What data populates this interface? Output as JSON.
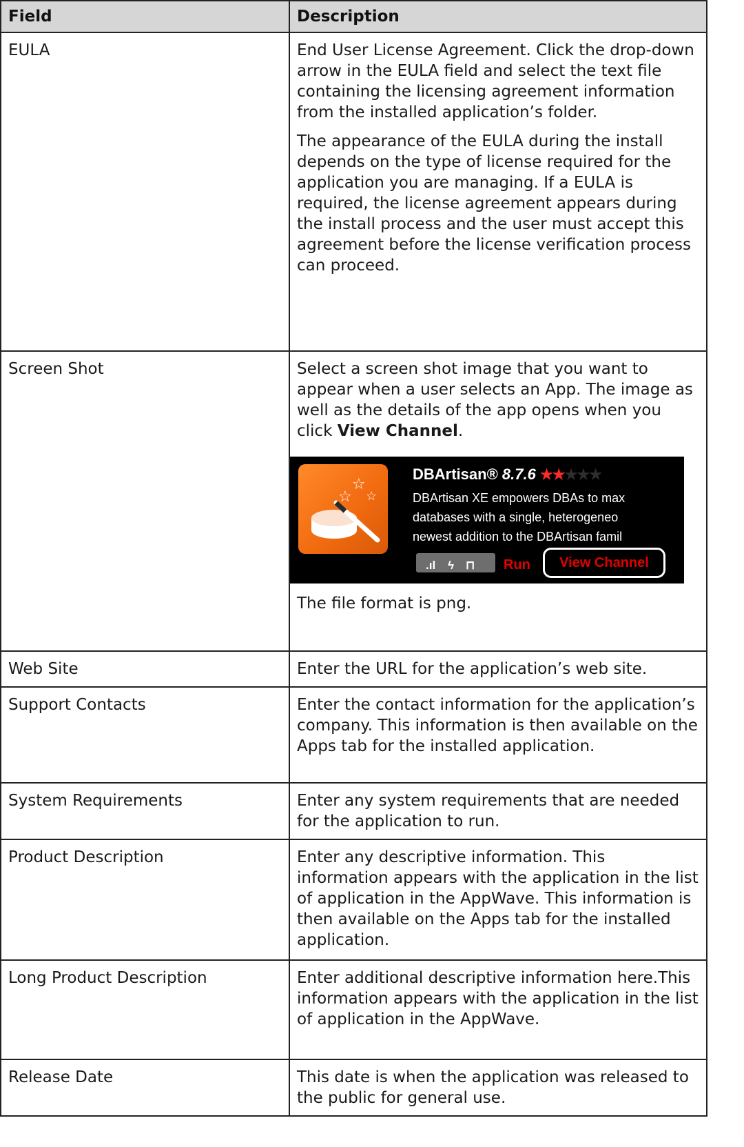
{
  "headers": {
    "field": "Field",
    "description": "Description"
  },
  "rows": [
    {
      "field": "EULA",
      "paragraphs": [
        "End User License Agreement. Click the drop-down arrow in the EULA field and select the text file containing the licensing agreement information from the installed application’s folder.",
        "The appearance of the EULA during the install depends on the type of license required for the application you are managing. If a EULA is required, the license agreement appears during the install process and the user must accept this agreement before the license verification process can proceed."
      ]
    },
    {
      "field": "Screen Shot",
      "intro": "Select a screen shot image that you want to appear when a user selects an App. The image as well as the details of the app opens when you click ",
      "intro_bold": "View Channel",
      "intro_end": ".",
      "after": "The file format is png."
    },
    {
      "field": "Web Site",
      "description": "Enter the URL for the application’s web site."
    },
    {
      "field": "Support Contacts",
      "description": "Enter the contact information for the application’s company. This information is then available on the Apps tab for the installed application."
    },
    {
      "field": "System Requirements",
      "description": "Enter any system requirements that are needed for the application to run."
    },
    {
      "field": "Product Description",
      "description": "Enter any descriptive information. This information appears with the application in the list of application in the AppWave. This information is then available on the Apps tab for the installed application."
    },
    {
      "field": "Long Product Description",
      "description": "Enter additional descriptive information here.This information appears with the application in the list of application in the AppWave."
    },
    {
      "field": "Release Date",
      "description": "This date is when the application was released to the public for general use."
    }
  ],
  "channel": {
    "app_name": "DBArtisan®",
    "version": "8.7.6",
    "rating": 2,
    "max_rating": 5,
    "stars_on": "★★",
    "stars_off": "★★★",
    "line1": "DBArtisan XE empowers DBAs to max",
    "line2": "databases with a single, heterogeneo",
    "line3": "newest addition to the DBArtisan famil",
    "status_icons": [
      "signal-icon",
      "lightning-icon",
      "unlock-icon"
    ],
    "status_glyphs": {
      "signal": ".ıl",
      "lightning": "ϟ",
      "unlock": "⊓"
    },
    "run_label": "Run",
    "view_channel_label": "View Channel",
    "icon_bg_color": "#f26b10",
    "link_color": "#e00000",
    "star_color": "#ff2a2a"
  }
}
